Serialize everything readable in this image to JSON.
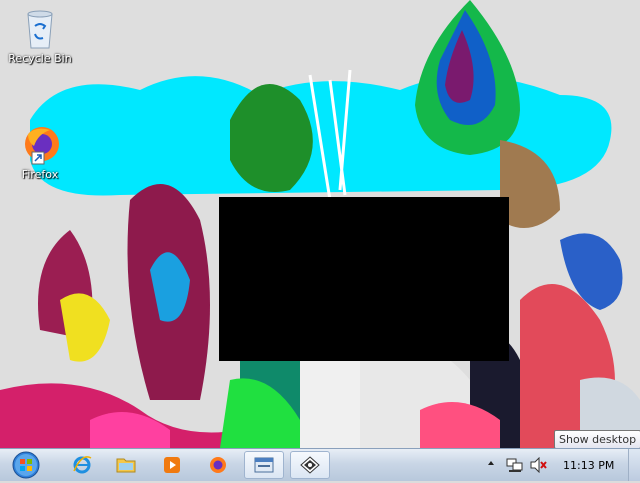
{
  "desktop": {
    "icons": [
      {
        "label": "Recycle Bin",
        "icon": "recycle-bin-icon"
      },
      {
        "label": "Firefox",
        "icon": "firefox-icon"
      }
    ]
  },
  "taskbar": {
    "pinned": [
      {
        "name": "internet-explorer",
        "icon": "internet-explorer-icon"
      },
      {
        "name": "windows-explorer",
        "icon": "folder-icon"
      },
      {
        "name": "media-player",
        "icon": "media-player-icon"
      },
      {
        "name": "firefox",
        "icon": "firefox-icon"
      },
      {
        "name": "app-window",
        "icon": "window-app-icon"
      },
      {
        "name": "app-running",
        "icon": "pattern-app-icon"
      }
    ],
    "tray": {
      "show_hidden_icon": "chevron-up-icon",
      "network_icon": "network-icon",
      "volume_icon": "volume-muted-icon",
      "clock": "11:13 PM"
    }
  },
  "tooltip": {
    "text": "Show desktop"
  },
  "colors": {
    "taskbar": "#c9d6e6",
    "sky": "#00e4ff",
    "window": "#000000"
  }
}
